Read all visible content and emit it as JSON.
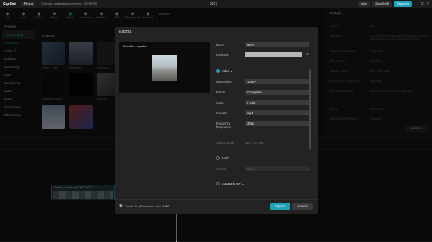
{
  "app": {
    "logo": "CapCut",
    "menu_label": "Menu",
    "saved_text": "Salvato automaticamente: 18:00:40",
    "project_name": "0927"
  },
  "titlebar_right": {
    "mia": "mia",
    "condividi": "Condividi",
    "esporta": "Esporta"
  },
  "toolbar": [
    {
      "label": "Ind.",
      "icon": "import-icon"
    },
    {
      "label": "Audio",
      "icon": "audio-icon"
    },
    {
      "label": "Testo",
      "icon": "text-icon"
    },
    {
      "label": "Sticker",
      "icon": "sticker-icon"
    },
    {
      "label": "Effetti",
      "icon": "effects-icon"
    },
    {
      "label": "Transizioni",
      "icon": "transition-icon"
    },
    {
      "label": "Sottotitoli",
      "icon": "subtitle-icon"
    },
    {
      "label": "Filtri",
      "icon": "filter-icon"
    },
    {
      "label": "Regolazione",
      "icon": "adjust-icon"
    },
    {
      "label": "Avatar AI",
      "icon": "avatar-icon"
    }
  ],
  "leftnav": {
    "items": [
      "Preferiti",
      "Scena sfugi",
      "Tendenze",
      "NOVITÀ",
      "Bellezza",
      "Meta/Daily",
      "Party",
      "Movimento",
      "LUCI",
      "Retrò",
      "Distorsione",
      "Effetti corpo"
    ],
    "selected_index": 1,
    "sub_index": 2
  },
  "media": {
    "heading": "Tendenze",
    "captions": [
      "Zoom di... forte",
      "Ingrandisci...",
      "Movimenti...",
      "Sfarfalli per gruppo",
      "Effetti di..."
    ]
  },
  "player": {
    "title": "Lettore"
  },
  "details": {
    "title": "Dettagli",
    "rows": [
      {
        "k": "Nome",
        "v": "0927"
      },
      {
        "k": "Percorso",
        "v": "C:/Users/MIO/AppData/Local/CapCut/User Data/Projects/com.lveditor.draft/0927"
      },
      {
        "k": "Rapporto d'aspetto",
        "v": "Originale"
      },
      {
        "k": "Risoluzione",
        "v": "Adattato"
      },
      {
        "k": "Spazio colore",
        "v": "Rec. 709 SDR"
      },
      {
        "k": "Frequenza fotogrammi",
        "v": "30.00fps"
      },
      {
        "k": "Importa materiale",
        "v": "Mantieni la posizione originale"
      },
      {
        "k": "Proxy",
        "v": "Disattivato"
      },
      {
        "k": "Disposizione libera",
        "v": "Attivato"
      }
    ],
    "modify_button": "Modifica"
  },
  "timeline": {
    "clip_label": "Ondata_animata.mp4  00:00:00:00"
  },
  "export_dialog": {
    "title": "Esporta",
    "preview_caption": "Modifica copertina",
    "name_label": "Nome",
    "name_value": "0927",
    "export_to_label": "Esporta in",
    "video_section": "Video",
    "fields": [
      {
        "label": "Risoluzione",
        "value": "1080P"
      },
      {
        "label": "Bit rate",
        "value": "Consigliato"
      },
      {
        "label": "Codec",
        "value": "H.264"
      },
      {
        "label": "Formato",
        "value": "mp4"
      },
      {
        "label": "Frequenza fotogrammi",
        "value": "30fps"
      }
    ],
    "color_space_label": "Spazio colore",
    "color_space_value": "Rec. 709 SDR",
    "audio_section": "Audio",
    "audio_format_label": "Formato",
    "audio_format_value": "MP3",
    "gif_section": "Esporta in GIF",
    "footer_info": "Durata: 6s | Dimensioni: circa 4 MB",
    "export_button": "Esporta",
    "cancel_button": "Annulla"
  },
  "colors": {
    "accent": "#1ea2b5",
    "dialog_bg": "#232323"
  }
}
